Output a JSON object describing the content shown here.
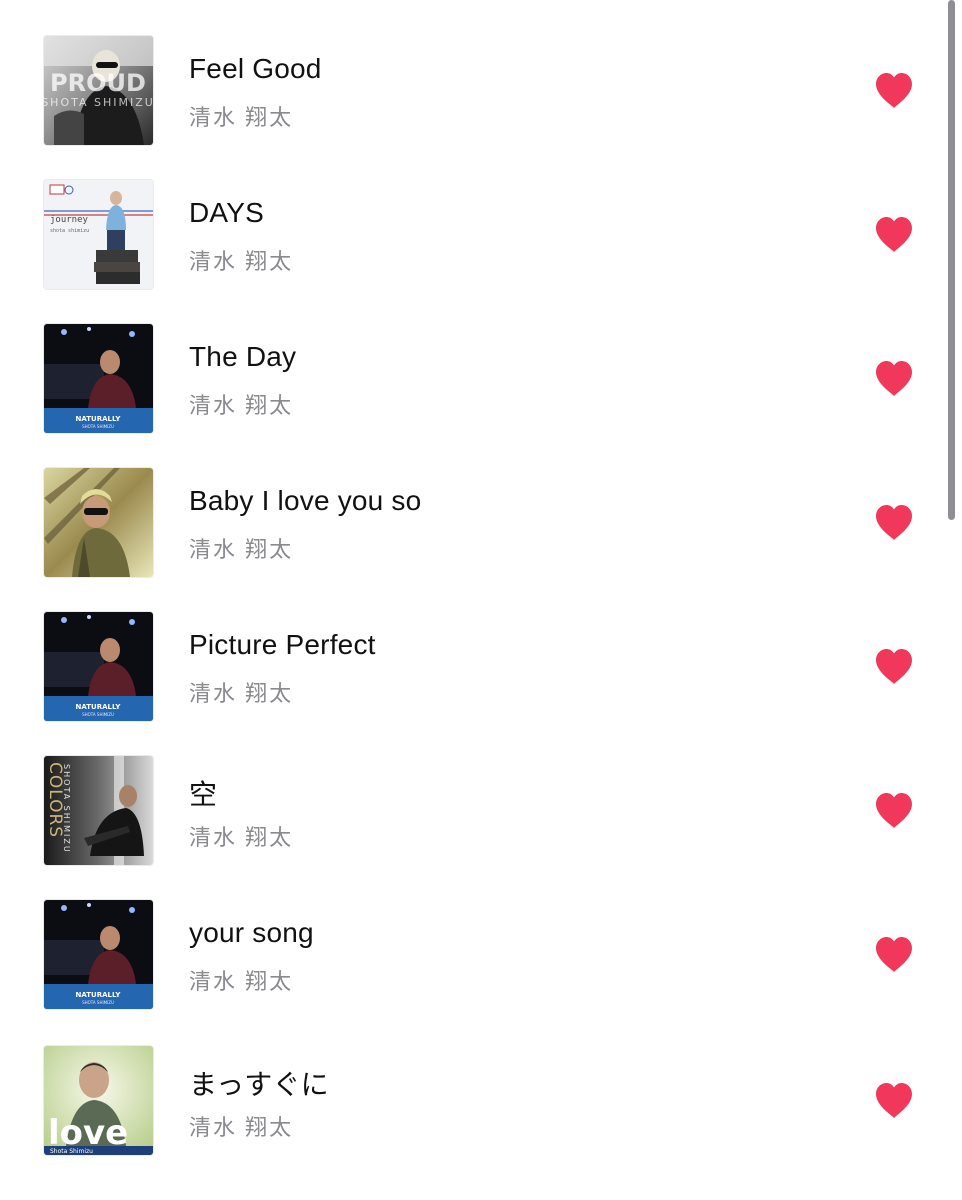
{
  "songs": [
    {
      "title": "Feel Good",
      "artist": "清水 翔太",
      "artwork": {
        "name": "album-art-proud",
        "text": "PROUD",
        "subtext": "SHOTA SHIMIZU"
      }
    },
    {
      "title": "DAYS",
      "artist": "清水 翔太",
      "artwork": {
        "name": "album-art-journey",
        "text": "journey",
        "subtext": "shota shimizu"
      }
    },
    {
      "title": "The Day",
      "artist": "清水 翔太",
      "artwork": {
        "name": "album-art-naturally",
        "text": "NATURALLY",
        "subtext": "SHOTA SHIMIZU"
      }
    },
    {
      "title": "Baby I love you so",
      "artist": "清水 翔太",
      "artwork": {
        "name": "album-art-baby-i-love-you-so"
      }
    },
    {
      "title": "Picture Perfect",
      "artist": "清水 翔太",
      "artwork": {
        "name": "album-art-naturally",
        "text": "NATURALLY",
        "subtext": "SHOTA SHIMIZU"
      }
    },
    {
      "title": "空",
      "artist": "清水 翔太",
      "artwork": {
        "name": "album-art-colors",
        "text": "COLORS",
        "subtext": "SHOTA SHIMIZU"
      }
    },
    {
      "title": "your song",
      "artist": "清水 翔太",
      "artwork": {
        "name": "album-art-naturally",
        "text": "NATURALLY",
        "subtext": "SHOTA SHIMIZU"
      }
    },
    {
      "title": "まっすぐに",
      "artist": "清水 翔太",
      "artwork": {
        "name": "album-art-love",
        "text": "love",
        "subtext": "Shota Shimizu"
      }
    }
  ],
  "colors": {
    "heart": "#f2385a",
    "title": "#111111",
    "artist": "#8a8a8e",
    "scrollbar": "#8e8e93"
  },
  "icons": {
    "love": "heart-icon"
  }
}
